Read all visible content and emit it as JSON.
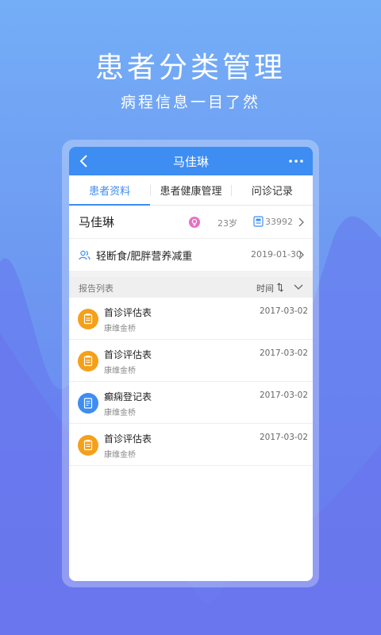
{
  "hero": {
    "title": "患者分类管理",
    "subtitle": "病程信息一目了然"
  },
  "app": {
    "title": "马佳琳",
    "tabs": [
      "患者资料",
      "患者健康管理",
      "问诊记录"
    ],
    "active_tab": 0
  },
  "patient": {
    "name": "马佳琳",
    "age": "23岁",
    "card_number": "33992"
  },
  "diagnosis": {
    "text": "轻断食/肥胖营养减重",
    "date": "2019-01-30"
  },
  "reports": {
    "header_label": "报告列表",
    "sort_label": "时间",
    "items": [
      {
        "title": "首诊评估表",
        "subtitle": "康维金桥",
        "date": "2017-03-02",
        "icon": "clipboard-icon",
        "color": "#f5a01a"
      },
      {
        "title": "首诊评估表",
        "subtitle": "康维金桥",
        "date": "2017-03-02",
        "icon": "clipboard-icon",
        "color": "#f5a01a"
      },
      {
        "title": "癫痫登记表",
        "subtitle": "康维金桥",
        "date": "2017-03-02",
        "icon": "document-icon",
        "color": "#3d8df2"
      },
      {
        "title": "首诊评估表",
        "subtitle": "康维金桥",
        "date": "2017-03-02",
        "icon": "clipboard-icon",
        "color": "#f5a01a"
      }
    ]
  },
  "colors": {
    "accent": "#3d8df2",
    "orange": "#f5a01a",
    "female": "#e96fc1"
  }
}
